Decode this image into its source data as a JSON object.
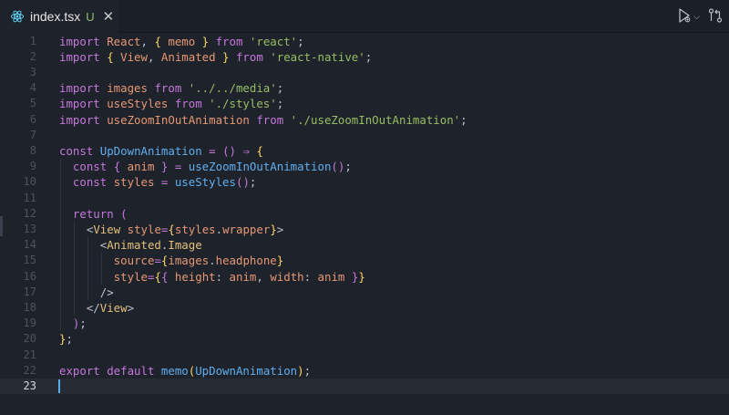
{
  "tab": {
    "title": "index.tsx",
    "badge": "U",
    "close_label": "✕",
    "icon": "react-icon",
    "accent_color": "#51afef"
  },
  "toolbar": {
    "run_icon": "run-debug-icon",
    "chevron": "⌵",
    "compare_icon": "git-compare-icon"
  },
  "editor": {
    "current_line": 23,
    "lines": [
      {
        "n": "1",
        "tokens": [
          [
            "kw",
            "import "
          ],
          [
            "var",
            "React"
          ],
          [
            "punc",
            ", "
          ],
          [
            "brk",
            "{ "
          ],
          [
            "var",
            "memo"
          ],
          [
            "brk",
            " }"
          ],
          [
            "kw",
            " from "
          ],
          [
            "str",
            "'react'"
          ],
          [
            "punc",
            ";"
          ]
        ]
      },
      {
        "n": "2",
        "tokens": [
          [
            "kw",
            "import "
          ],
          [
            "brk",
            "{ "
          ],
          [
            "var",
            "View"
          ],
          [
            "punc",
            ", "
          ],
          [
            "var",
            "Animated"
          ],
          [
            "brk",
            " }"
          ],
          [
            "kw",
            " from "
          ],
          [
            "str",
            "'react-native'"
          ],
          [
            "punc",
            ";"
          ]
        ]
      },
      {
        "n": "3",
        "tokens": []
      },
      {
        "n": "4",
        "tokens": [
          [
            "kw",
            "import "
          ],
          [
            "var",
            "images"
          ],
          [
            "kw",
            " from "
          ],
          [
            "str",
            "'../../media'"
          ],
          [
            "punc",
            ";"
          ]
        ]
      },
      {
        "n": "5",
        "tokens": [
          [
            "kw",
            "import "
          ],
          [
            "var",
            "useStyles"
          ],
          [
            "kw",
            " from "
          ],
          [
            "str",
            "'./styles'"
          ],
          [
            "punc",
            ";"
          ]
        ]
      },
      {
        "n": "6",
        "tokens": [
          [
            "kw",
            "import "
          ],
          [
            "var",
            "useZoomInOutAnimation"
          ],
          [
            "kw",
            " from "
          ],
          [
            "str",
            "'./useZoomInOutAnimation'"
          ],
          [
            "punc",
            ";"
          ]
        ]
      },
      {
        "n": "7",
        "tokens": []
      },
      {
        "n": "8",
        "tokens": [
          [
            "kw",
            "const "
          ],
          [
            "fn",
            "UpDownAnimation"
          ],
          [
            "op",
            " = "
          ],
          [
            "brk2",
            "()"
          ],
          [
            "op",
            " ⇒ "
          ],
          [
            "brk",
            "{"
          ]
        ]
      },
      {
        "n": "9",
        "tokens": [
          [
            "punc",
            "  "
          ],
          [
            "kw",
            "const "
          ],
          [
            "brk2",
            "{ "
          ],
          [
            "var",
            "anim"
          ],
          [
            "brk2",
            " }"
          ],
          [
            "op",
            " = "
          ],
          [
            "fn",
            "useZoomInOutAnimation"
          ],
          [
            "brk2",
            "()"
          ],
          [
            "punc",
            ";"
          ]
        ]
      },
      {
        "n": "10",
        "tokens": [
          [
            "punc",
            "  "
          ],
          [
            "kw",
            "const "
          ],
          [
            "var",
            "styles"
          ],
          [
            "op",
            " = "
          ],
          [
            "fn",
            "useStyles"
          ],
          [
            "brk2",
            "()"
          ],
          [
            "punc",
            ";"
          ]
        ]
      },
      {
        "n": "11",
        "tokens": []
      },
      {
        "n": "12",
        "tokens": [
          [
            "punc",
            "  "
          ],
          [
            "kw",
            "return "
          ],
          [
            "brk2",
            "("
          ]
        ]
      },
      {
        "n": "13",
        "tokens": [
          [
            "punc",
            "    <"
          ],
          [
            "tag",
            "View"
          ],
          [
            "prop",
            " style"
          ],
          [
            "op",
            "="
          ],
          [
            "brk",
            "{"
          ],
          [
            "var",
            "styles"
          ],
          [
            "punc",
            "."
          ],
          [
            "prop",
            "wrapper"
          ],
          [
            "brk",
            "}"
          ],
          [
            "punc",
            ">"
          ]
        ]
      },
      {
        "n": "14",
        "tokens": [
          [
            "punc",
            "      <"
          ],
          [
            "tag",
            "Animated"
          ],
          [
            "punc",
            "."
          ],
          [
            "tag",
            "Image"
          ]
        ]
      },
      {
        "n": "15",
        "tokens": [
          [
            "punc",
            "        "
          ],
          [
            "prop",
            "source"
          ],
          [
            "op",
            "="
          ],
          [
            "brk",
            "{"
          ],
          [
            "var",
            "images"
          ],
          [
            "punc",
            "."
          ],
          [
            "prop",
            "headphone"
          ],
          [
            "brk",
            "}"
          ]
        ]
      },
      {
        "n": "16",
        "tokens": [
          [
            "punc",
            "        "
          ],
          [
            "prop",
            "style"
          ],
          [
            "op",
            "="
          ],
          [
            "brk",
            "{"
          ],
          [
            "brk2",
            "{ "
          ],
          [
            "prop",
            "height"
          ],
          [
            "punc",
            ": "
          ],
          [
            "var",
            "anim"
          ],
          [
            "punc",
            ", "
          ],
          [
            "prop",
            "width"
          ],
          [
            "punc",
            ": "
          ],
          [
            "var",
            "anim"
          ],
          [
            "brk2",
            " }"
          ],
          [
            "brk",
            "}"
          ]
        ]
      },
      {
        "n": "17",
        "tokens": [
          [
            "punc",
            "      />"
          ]
        ]
      },
      {
        "n": "18",
        "tokens": [
          [
            "punc",
            "    </"
          ],
          [
            "tag",
            "View"
          ],
          [
            "punc",
            ">"
          ]
        ]
      },
      {
        "n": "19",
        "tokens": [
          [
            "punc",
            "  "
          ],
          [
            "brk2",
            ")"
          ],
          [
            "punc",
            ";"
          ]
        ]
      },
      {
        "n": "20",
        "tokens": [
          [
            "brk",
            "}"
          ],
          [
            "punc",
            ";"
          ]
        ]
      },
      {
        "n": "21",
        "tokens": []
      },
      {
        "n": "22",
        "tokens": [
          [
            "kw",
            "export "
          ],
          [
            "kw",
            "default "
          ],
          [
            "fn",
            "memo"
          ],
          [
            "brk",
            "("
          ],
          [
            "fn",
            "UpDownAnimation"
          ],
          [
            "brk",
            ")"
          ],
          [
            "punc",
            ";"
          ]
        ]
      },
      {
        "n": "23",
        "tokens": []
      }
    ]
  }
}
